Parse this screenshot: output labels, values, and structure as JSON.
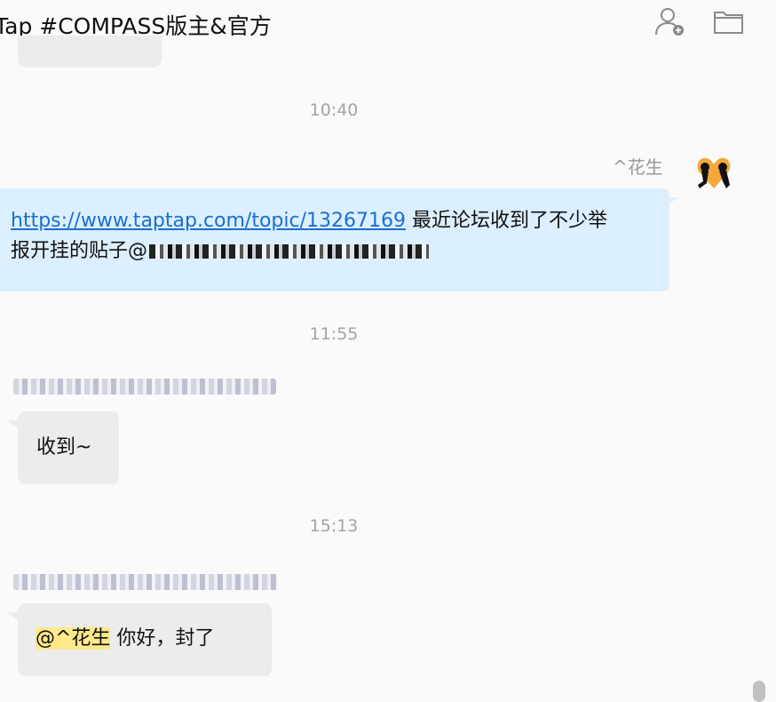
{
  "header": {
    "title": "Tap #COMPASS版主&官方",
    "add_member_icon": "user-plus-icon",
    "folder_icon": "folder-icon"
  },
  "timestamps": [
    "10:40",
    "11:55",
    "15:13"
  ],
  "messages": [
    {
      "sender": "^花生",
      "side": "right",
      "link": "https://www.taptap.com/topic/13267169",
      "text_line1": " 最近论坛收到了不少举",
      "text_line2": "报开挂的贴子@"
    },
    {
      "side": "left",
      "text": "收到~"
    },
    {
      "side": "left",
      "mention": "@^花生",
      "text": " 你好，封了"
    }
  ],
  "colors": {
    "right_bubble": "#dcefff",
    "left_bubble": "#ececec",
    "link": "#1a6fd1",
    "mention_highlight": "#ffe98a"
  }
}
